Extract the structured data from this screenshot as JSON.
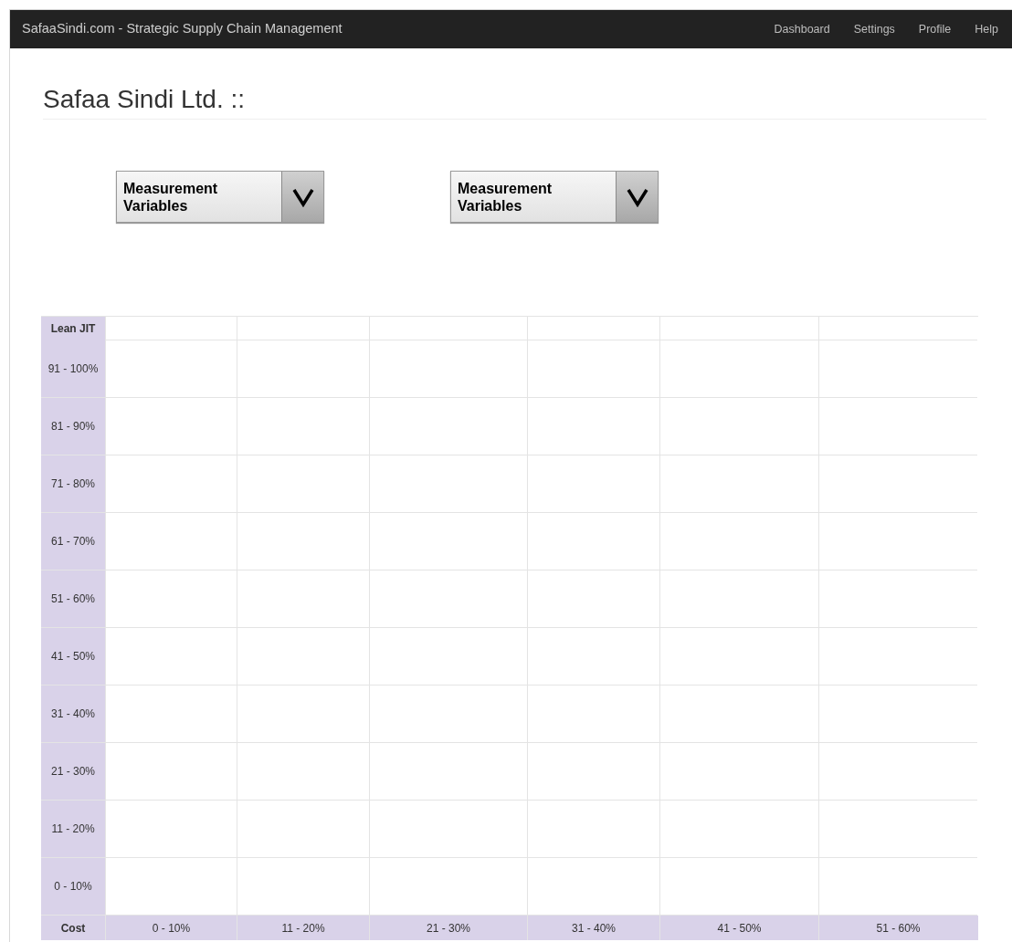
{
  "navbar": {
    "brand": "SafaaSindi.com - Strategic Supply Chain Management",
    "links": [
      "Dashboard",
      "Settings",
      "Profile",
      "Help"
    ]
  },
  "page_title": "Safaa Sindi Ltd. ::",
  "dropdowns": [
    {
      "label": "Measurement Variables"
    },
    {
      "label": "Measurement Variables"
    }
  ],
  "grid": {
    "y_axis_title": "Lean JIT",
    "x_axis_title": "Cost",
    "row_labels": [
      "91 - 100%",
      "81 - 90%",
      "71 - 80%",
      "61 - 70%",
      "51 - 60%",
      "41 - 50%",
      "31 - 40%",
      "21 - 30%",
      "11 - 20%",
      "0 - 10%"
    ],
    "column_labels": [
      "0 - 10%",
      "11 - 20%",
      "21 - 30%",
      "31 - 40%",
      "41 - 50%",
      "51 - 60%"
    ]
  }
}
